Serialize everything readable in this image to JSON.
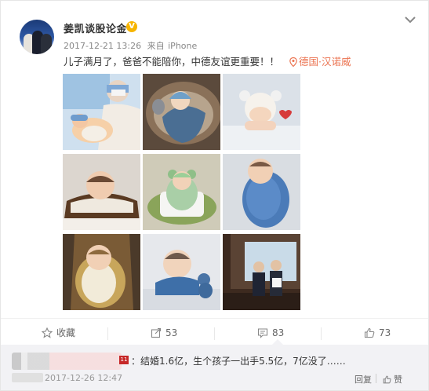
{
  "post": {
    "username": "姜凯谈股论金",
    "verified_badge": "V",
    "timestamp": "2017-12-21 13:26",
    "source_prefix": "来自",
    "source": "iPhone",
    "text": "儿子满月了，爸爸不能陪你，中德友谊更重要！！",
    "location": "德国·汉诺威"
  },
  "actions": {
    "favorite_label": "收藏",
    "repost_count": "53",
    "comment_count": "83",
    "like_count": "73"
  },
  "comment": {
    "text": "：结婚1.6亿，生个孩子一出手5.5亿，7亿没了……",
    "timestamp": "2017-12-26 12:47",
    "reply_label": "回复",
    "like_label": "赞"
  },
  "photos": [
    {
      "name": "photo-1"
    },
    {
      "name": "photo-2"
    },
    {
      "name": "photo-3"
    },
    {
      "name": "photo-4"
    },
    {
      "name": "photo-5"
    },
    {
      "name": "photo-6"
    },
    {
      "name": "photo-7"
    },
    {
      "name": "photo-8"
    },
    {
      "name": "photo-9"
    }
  ],
  "colors": {
    "location": "#eb7350",
    "badge": "#f7b500",
    "comment_bg": "#f2f2f5"
  }
}
